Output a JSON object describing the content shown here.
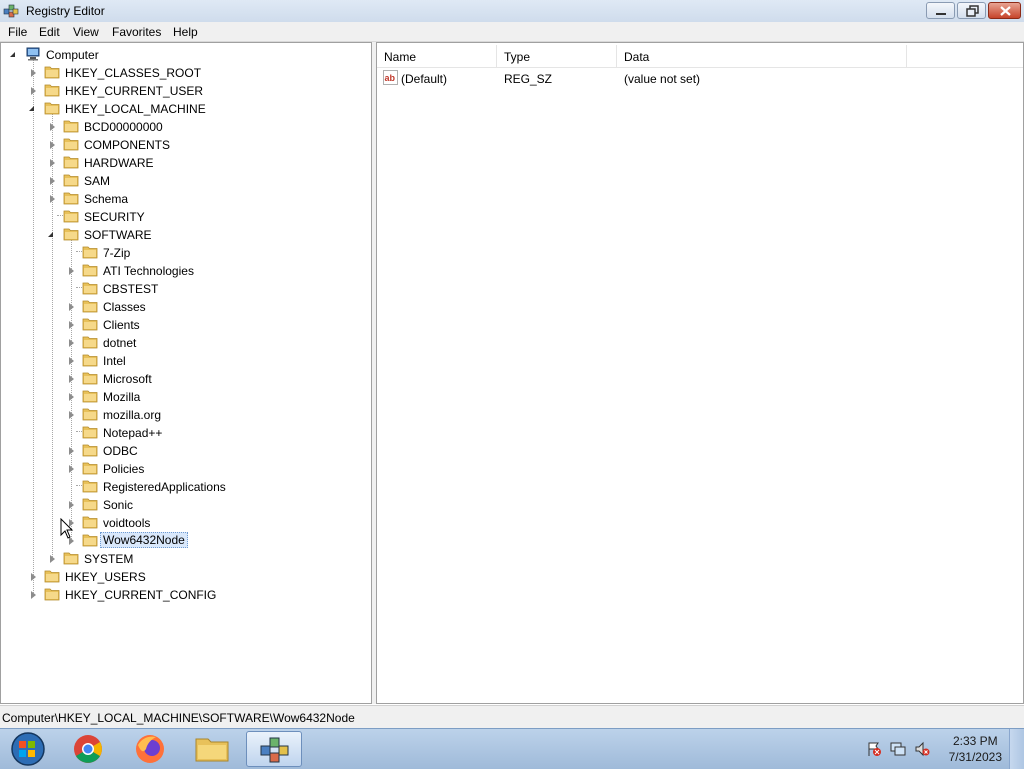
{
  "window": {
    "title": "Registry Editor"
  },
  "menu": [
    "File",
    "Edit",
    "View",
    "Favorites",
    "Help"
  ],
  "tree": {
    "root": "Computer",
    "hives": [
      {
        "label": "HKEY_CLASSES_ROOT",
        "state": "collapsed"
      },
      {
        "label": "HKEY_CURRENT_USER",
        "state": "collapsed"
      },
      {
        "label": "HKEY_LOCAL_MACHINE",
        "state": "expanded"
      },
      {
        "label": "HKEY_USERS",
        "state": "collapsed"
      },
      {
        "label": "HKEY_CURRENT_CONFIG",
        "state": "collapsed"
      }
    ],
    "hklm_children": [
      {
        "label": "BCD00000000",
        "state": "collapsed"
      },
      {
        "label": "COMPONENTS",
        "state": "collapsed"
      },
      {
        "label": "HARDWARE",
        "state": "collapsed"
      },
      {
        "label": "SAM",
        "state": "collapsed"
      },
      {
        "label": "Schema",
        "state": "collapsed"
      },
      {
        "label": "SECURITY",
        "state": "leaf"
      },
      {
        "label": "SOFTWARE",
        "state": "expanded"
      },
      {
        "label": "SYSTEM",
        "state": "collapsed"
      }
    ],
    "software_children": [
      {
        "label": "7-Zip",
        "state": "leaf"
      },
      {
        "label": "ATI Technologies",
        "state": "collapsed"
      },
      {
        "label": "CBSTEST",
        "state": "leaf"
      },
      {
        "label": "Classes",
        "state": "collapsed"
      },
      {
        "label": "Clients",
        "state": "collapsed"
      },
      {
        "label": "dotnet",
        "state": "collapsed"
      },
      {
        "label": "Intel",
        "state": "collapsed"
      },
      {
        "label": "Microsoft",
        "state": "collapsed"
      },
      {
        "label": "Mozilla",
        "state": "collapsed"
      },
      {
        "label": "mozilla.org",
        "state": "collapsed"
      },
      {
        "label": "Notepad++",
        "state": "leaf"
      },
      {
        "label": "ODBC",
        "state": "collapsed"
      },
      {
        "label": "Policies",
        "state": "collapsed"
      },
      {
        "label": "RegisteredApplications",
        "state": "leaf"
      },
      {
        "label": "Sonic",
        "state": "collapsed"
      },
      {
        "label": "voidtools",
        "state": "collapsed"
      },
      {
        "label": "Wow6432Node",
        "state": "collapsed",
        "selected": true
      }
    ]
  },
  "list": {
    "columns": [
      "Name",
      "Type",
      "Data"
    ],
    "rows": [
      {
        "name": "(Default)",
        "type": "REG_SZ",
        "data": "(value not set)",
        "icon": "string-value-icon"
      }
    ]
  },
  "status": {
    "path": "Computer\\HKEY_LOCAL_MACHINE\\SOFTWARE\\Wow6432Node"
  },
  "taskbar": {
    "items": [
      "start-orb",
      "chrome",
      "firefox",
      "file-explorer",
      "registry-editor"
    ],
    "active": "registry-editor",
    "time": "2:33 PM",
    "date": "7/31/2023"
  },
  "colors": {
    "folder": "#e8c15a",
    "selection": "#d9e8fb",
    "taskbar": "#a9c3e0"
  }
}
